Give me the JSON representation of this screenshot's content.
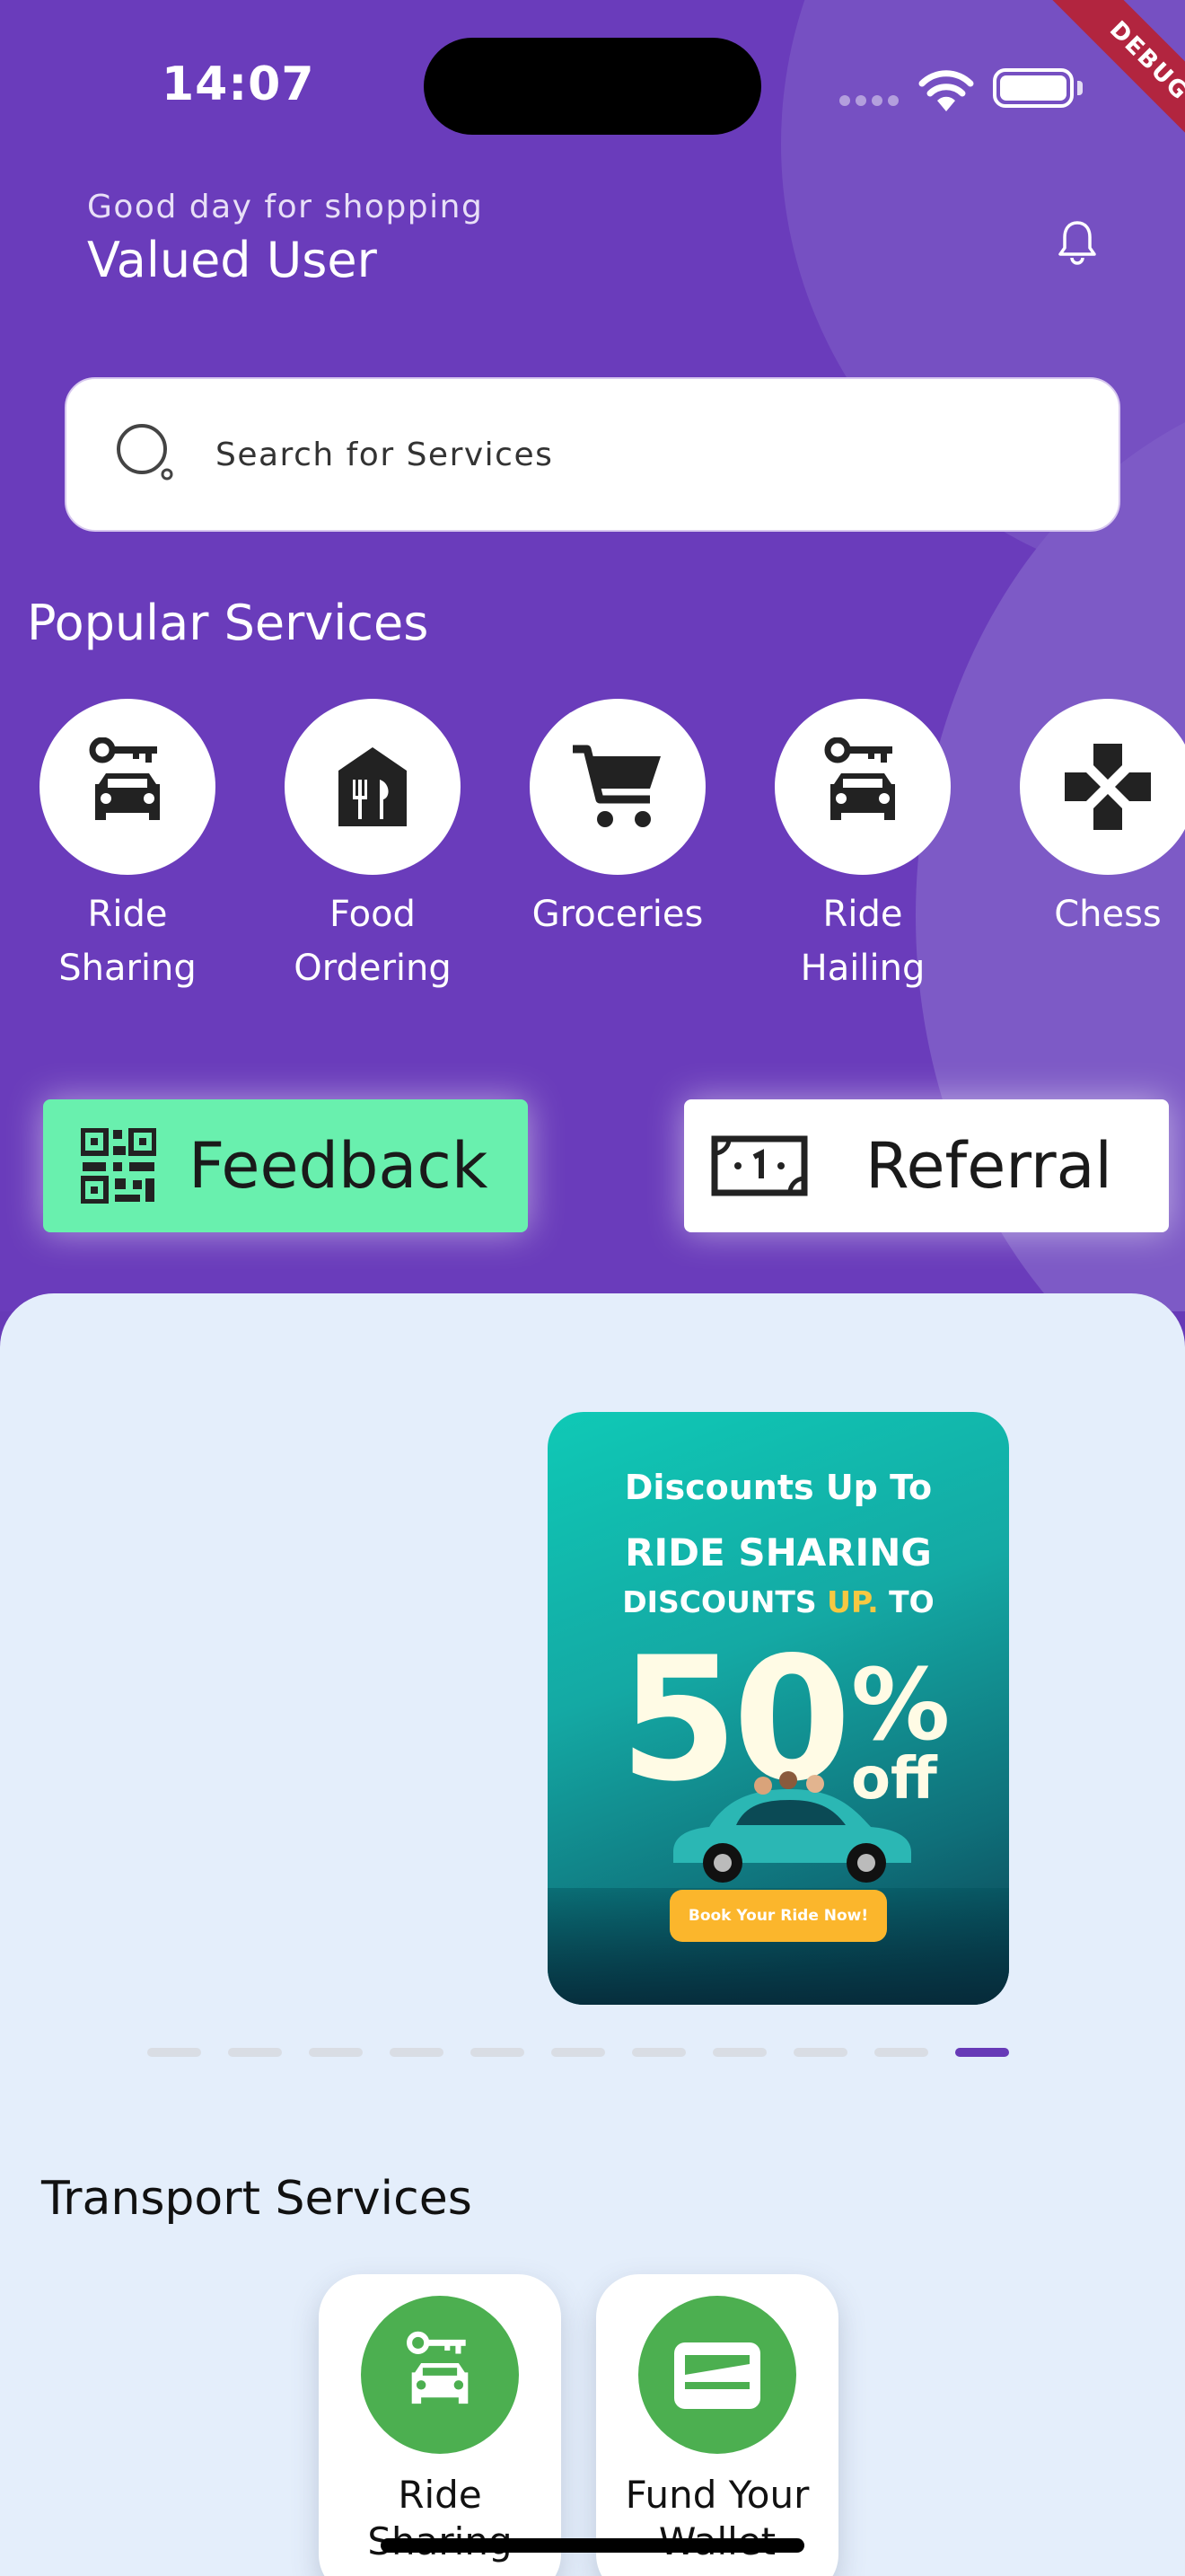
{
  "status_bar": {
    "time": "14:07",
    "debug_label": "DEBUG"
  },
  "header": {
    "greeting": "Good day for shopping",
    "user_name": "Valued User"
  },
  "search": {
    "placeholder": "Search for Services"
  },
  "popular": {
    "title": "Popular Services",
    "items": [
      {
        "label": "Ride\nSharing",
        "icon": "car-key-icon"
      },
      {
        "label": "Food\nOrdering",
        "icon": "restaurant-icon"
      },
      {
        "label": "Groceries",
        "icon": "cart-icon"
      },
      {
        "label": "Ride\nHailing",
        "icon": "car-key-icon"
      },
      {
        "label": "Chess",
        "icon": "gamepad-icon"
      }
    ]
  },
  "actions": {
    "feedback": {
      "label": "Feedback",
      "icon": "qr-code-icon"
    },
    "referral": {
      "label": "Referral",
      "icon": "money-note-icon"
    }
  },
  "banner": {
    "line1": "Discounts Up To",
    "line2": "RIDE SHARING",
    "line3a": "DISCOUNTS ",
    "line3b": "UP.",
    "line3c": " TO",
    "big_number": "50",
    "percent": "%",
    "off": "off",
    "cta": "Book Your Ride Now!",
    "page_count": 11,
    "active_page": 11
  },
  "transport": {
    "title": "Transport Services",
    "items": [
      {
        "label": "Ride\nSharing",
        "icon": "car-key-icon"
      },
      {
        "label": "Fund Your\nWallet",
        "icon": "wallet-icon"
      }
    ]
  },
  "colors": {
    "primary": "#673ab7",
    "feedback_bg": "#69f0ae",
    "transport_icon_bg": "#4caf50",
    "sheet_bg": "#e4eefb"
  }
}
